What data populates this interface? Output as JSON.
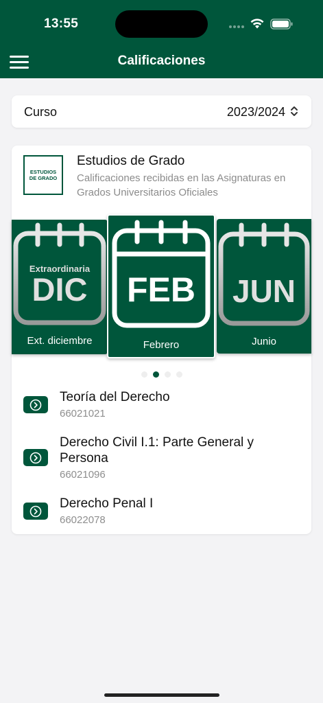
{
  "status_bar": {
    "time": "13:55"
  },
  "header": {
    "title": "Calificaciones"
  },
  "curso": {
    "label": "Curso",
    "value": "2023/2024"
  },
  "grado": {
    "logo_text": "ESTUDIOS DE GRADO",
    "title": "Estudios de Grado",
    "subtitle": "Calificaciones recibidas en las Asignaturas en Grados Universitarios Oficiales"
  },
  "convocatorias": [
    {
      "top_label": "Extraordinaria",
      "month": "DIC",
      "caption": "Ext. diciembre"
    },
    {
      "top_label": "",
      "month": "FEB",
      "caption": "Febrero"
    },
    {
      "top_label": "",
      "month": "JUN",
      "caption": "Junio"
    }
  ],
  "pagination": {
    "count": 4,
    "active_index": 1
  },
  "subjects": [
    {
      "name": "Teoría del Derecho",
      "code": "66021021"
    },
    {
      "name": "Derecho Civil I.1: Parte General y Persona",
      "code": "66021096"
    },
    {
      "name": "Derecho Penal I",
      "code": "66022078"
    }
  ],
  "colors": {
    "primary": "#00563b",
    "background": "#f3f3f5"
  }
}
